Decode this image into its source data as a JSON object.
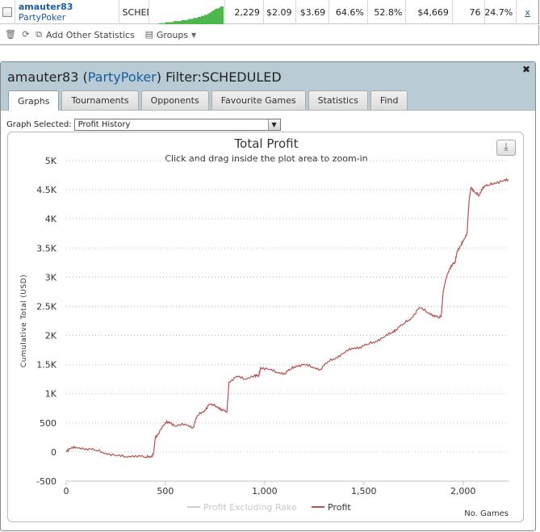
{
  "top_row": {
    "player_name": "amauter83",
    "site": "PartyPoker",
    "filter_short": "SCHED",
    "cells": [
      "2,229",
      "$2.09",
      "$3.69",
      "64.6%",
      "52.8%",
      "$4,669",
      "76",
      "24.7%"
    ],
    "remove_label": "x",
    "sparkline_bars": [
      1,
      1,
      1,
      1,
      2,
      2,
      2,
      2,
      2,
      3,
      3,
      3,
      3,
      3,
      4,
      4,
      4,
      4,
      5,
      5,
      5,
      6,
      6,
      6,
      7,
      7,
      8,
      8,
      9,
      9,
      10,
      11,
      12,
      13,
      14,
      15,
      15,
      16,
      17,
      17
    ]
  },
  "toolbar": {
    "add_stats_label": "Add Other Statistics",
    "groups_label": "Groups"
  },
  "panel": {
    "player_name": "amauter83",
    "site": "PartyPoker",
    "filter_label": "Filter:SCHEDULED",
    "tabs": [
      {
        "label": "Graphs",
        "active": true
      },
      {
        "label": "Tournaments",
        "active": false
      },
      {
        "label": "Opponents",
        "active": false
      },
      {
        "label": "Favourite Games",
        "active": false
      },
      {
        "label": "Statistics",
        "active": false
      },
      {
        "label": "Find",
        "active": false
      }
    ],
    "graph_selected_label": "Graph Selected:",
    "graph_selected_value": "Profit History"
  },
  "colors": {
    "profit_line": "#b5504e",
    "excl_rake_line": "#cccccc",
    "header_bg": "#b9cbd5",
    "sparkline": "#4cb84c",
    "link": "#1a5da0"
  },
  "chart_data": {
    "type": "line",
    "title": "Total Profit",
    "subtitle": "Click and drag inside the plot area to zoom-in",
    "ylabel": "Cumulative Total (USD)",
    "xlabel": "No. Games",
    "ylim": [
      -500,
      5000
    ],
    "xlim": [
      0,
      2229
    ],
    "y_ticks": [
      -500,
      0,
      500,
      1000,
      1500,
      2000,
      2500,
      3000,
      3500,
      4000,
      4500,
      5000
    ],
    "y_tick_labels": [
      "-500",
      "0",
      "500",
      "1K",
      "1.5K",
      "2K",
      "2.5K",
      "3K",
      "3.5K",
      "4K",
      "4.5K",
      "5K"
    ],
    "x_ticks": [
      0,
      500,
      1000,
      1500,
      2000
    ],
    "x_tick_labels": [
      "0",
      "500",
      "1,000",
      "1,500",
      "2,000"
    ],
    "grid": true,
    "legend_position": "bottom-center",
    "series": [
      {
        "name": "Profit Excluding Rake",
        "x": [],
        "y": []
      },
      {
        "name": "Profit",
        "x": [
          0,
          20,
          50,
          100,
          150,
          200,
          250,
          300,
          350,
          400,
          430,
          440,
          450,
          460,
          500,
          520,
          550,
          600,
          640,
          660,
          700,
          720,
          760,
          780,
          810,
          820,
          860,
          900,
          950,
          970,
          980,
          1020,
          1060,
          1100,
          1130,
          1160,
          1200,
          1240,
          1280,
          1320,
          1360,
          1400,
          1440,
          1480,
          1520,
          1560,
          1600,
          1640,
          1660,
          1700,
          1740,
          1780,
          1820,
          1850,
          1880,
          1890,
          1900,
          1920,
          1940,
          1960,
          1970,
          1990,
          2000,
          2020,
          2030,
          2040,
          2060,
          2080,
          2100,
          2130,
          2160,
          2200,
          2229
        ],
        "y": [
          20,
          60,
          80,
          60,
          30,
          -20,
          -60,
          -80,
          -60,
          -90,
          -70,
          -30,
          260,
          300,
          500,
          520,
          440,
          480,
          420,
          620,
          720,
          820,
          780,
          740,
          680,
          1200,
          1300,
          1250,
          1320,
          1300,
          1450,
          1420,
          1370,
          1350,
          1420,
          1480,
          1500,
          1460,
          1420,
          1550,
          1620,
          1700,
          1780,
          1800,
          1850,
          1900,
          1970,
          2050,
          2100,
          2200,
          2300,
          2480,
          2400,
          2350,
          2300,
          2350,
          2760,
          3050,
          3200,
          3250,
          3450,
          3550,
          3620,
          3760,
          4300,
          4550,
          4450,
          4400,
          4550,
          4580,
          4620,
          4650,
          4670
        ]
      }
    ]
  }
}
